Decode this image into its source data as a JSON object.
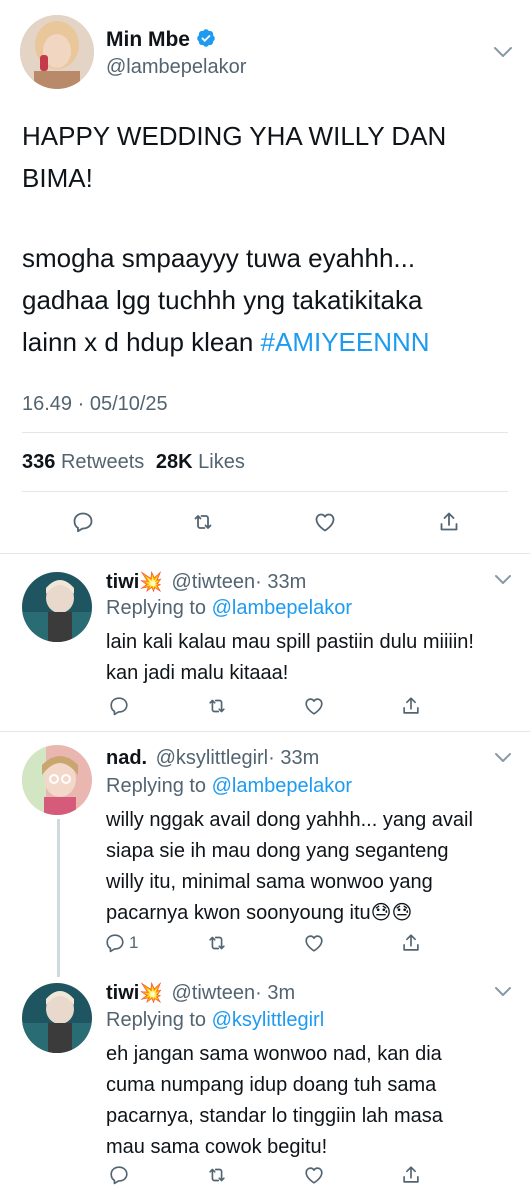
{
  "main_tweet": {
    "author_name": "Min Mbe",
    "author_handle": "@lambepelakor",
    "text_line1": "HAPPY WEDDING YHA WILLY DAN",
    "text_line2": "BIMA!",
    "text_line3": "smogha smpaayyy tuwa eyahhh...",
    "text_line4": "gadhaa lgg tuchhh yng takatikitaka",
    "text_line5_prefix": "lainn x d hdup klean ",
    "text_line5_hashtag": "#AMIYEENNN",
    "timestamp": "16.49 · 05/10/25",
    "retweets_count": "336",
    "retweets_label": "Retweets",
    "likes_count": "28K",
    "likes_label": "Likes"
  },
  "replies": [
    {
      "name": "tiwi",
      "emoji": "💥",
      "handle": "@tiwteen",
      "time": "· 33m",
      "replying_label": "Replying to",
      "replying_handle": "@lambepelakor",
      "lines": [
        "lain kali kalau mau spill pastiin dulu miiiin!",
        "kan jadi malu kitaaa!"
      ],
      "reply_count": ""
    },
    {
      "name": "nad.",
      "emoji": "",
      "handle": "@ksylittlegirl",
      "time": "· 33m",
      "replying_label": "Replying to",
      "replying_handle": "@lambepelakor",
      "lines": [
        "willy nggak avail dong yahhh... yang avail",
        "siapa sie ih mau dong yang seganteng",
        "willy itu, minimal sama wonwoo yang",
        "pacarnya kwon soonyoung itu😓😓"
      ],
      "reply_count": "1"
    },
    {
      "name": "tiwi",
      "emoji": "💥",
      "handle": "@tiwteen",
      "time": "· 3m",
      "replying_label": "Replying to",
      "replying_handle": "@ksylittlegirl",
      "lines": [
        "eh jangan sama wonwoo nad, kan dia",
        "cuma numpang idup doang tuh sama",
        "pacarnya, standar lo tinggiin lah masa",
        "mau sama cowok begitu!"
      ],
      "reply_count": ""
    }
  ],
  "icons": {
    "reply": "reply-icon",
    "retweet": "retweet-icon",
    "like": "heart-icon",
    "share": "share-icon",
    "more": "chevron-down-icon",
    "verified": "verified-badge-icon"
  },
  "colors": {
    "accent": "#1d9bf0",
    "text": "#0f1419",
    "muted": "#536471",
    "divider": "#e1e8ed"
  }
}
